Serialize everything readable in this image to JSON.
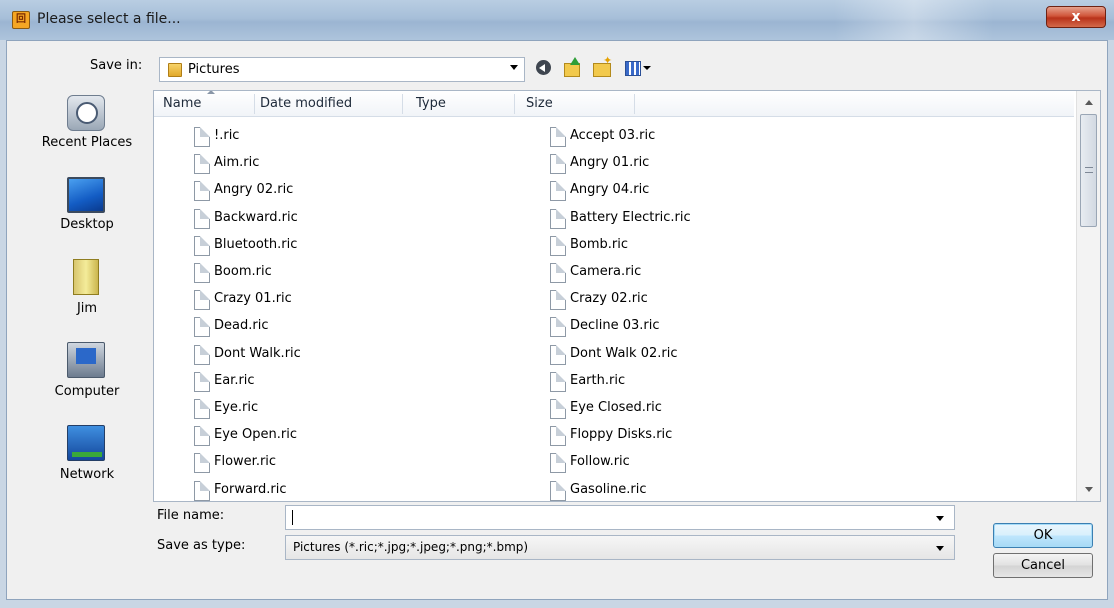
{
  "window": {
    "title": "Please select a file...",
    "close_label": "x",
    "app_icon_glyph": "回"
  },
  "toolbar": {
    "save_in_label": "Save in:",
    "current_folder": "Pictures"
  },
  "places": [
    {
      "label": "Recent Places",
      "icon": "recent-places-icon"
    },
    {
      "label": "Desktop",
      "icon": "desktop-icon"
    },
    {
      "label": "Jim",
      "icon": "user-folder-icon"
    },
    {
      "label": "Computer",
      "icon": "computer-icon"
    },
    {
      "label": "Network",
      "icon": "network-icon"
    }
  ],
  "columns": [
    "Name",
    "Date modified",
    "Type",
    "Size"
  ],
  "files_left": [
    "!.ric",
    "Aim.ric",
    "Angry 02.ric",
    "Backward.ric",
    "Bluetooth.ric",
    "Boom.ric",
    "Crazy 01.ric",
    "Dead.ric",
    "Dont Walk.ric",
    "Ear.ric",
    "Eye.ric",
    "Eye Open.ric",
    "Flower.ric",
    "Forward.ric"
  ],
  "files_right": [
    "Accept 03.ric",
    "Angry 01.ric",
    "Angry 04.ric",
    "Battery Electric.ric",
    "Bomb.ric",
    "Camera.ric",
    "Crazy 02.ric",
    "Decline 03.ric",
    "Dont Walk 02.ric",
    "Earth.ric",
    "Eye Closed.ric",
    "Floppy Disks.ric",
    "Follow.ric",
    "Gasoline.ric"
  ],
  "footer": {
    "file_name_label": "File name:",
    "file_name_value": "",
    "save_as_type_label": "Save as type:",
    "save_as_type_value": "Pictures (*.ric;*.jpg;*.jpeg;*.png;*.bmp)",
    "ok_label": "OK",
    "cancel_label": "Cancel"
  },
  "colors": {
    "title_bar": "#a7bfd9",
    "dialog_bg": "#f0f0f0",
    "close_button": "#c8402a",
    "default_button_border": "#3c7fb1"
  }
}
